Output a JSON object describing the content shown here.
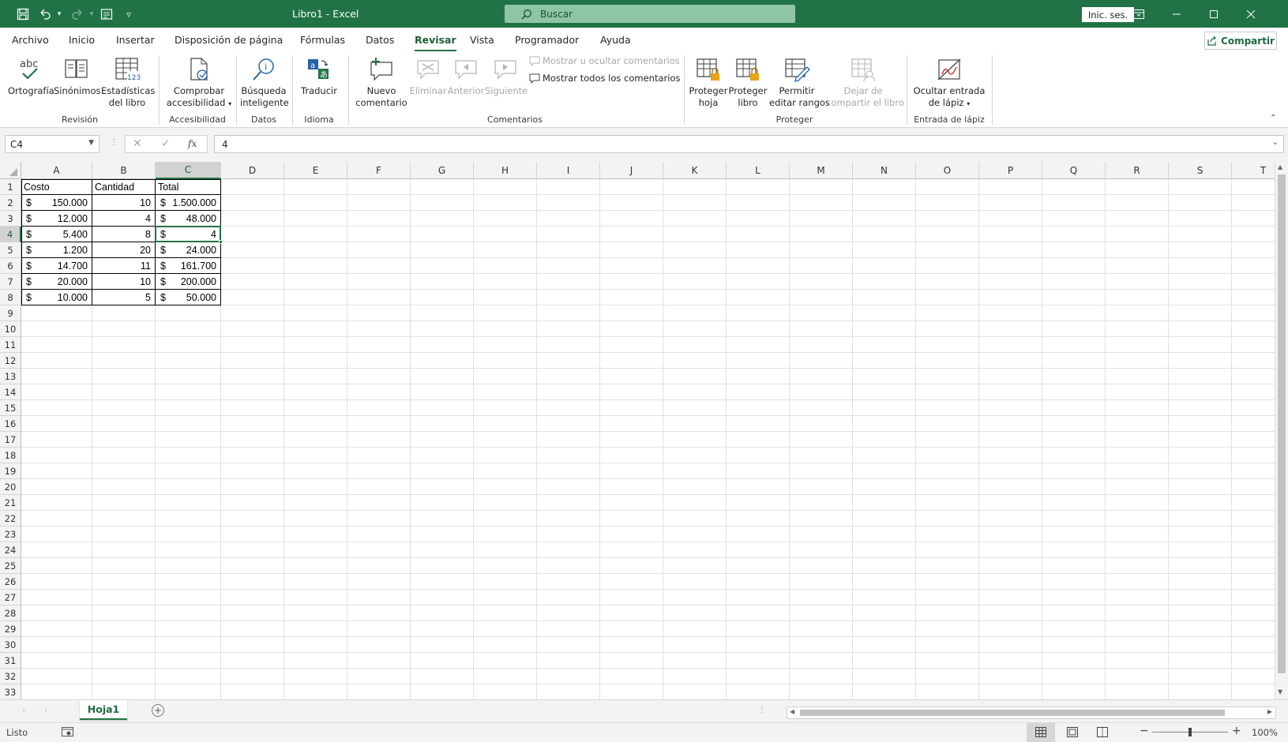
{
  "title_bar": {
    "title": "Libro1  -  Excel",
    "search_placeholder": "Buscar",
    "signin_label": "Inic. ses."
  },
  "menu_tabs": [
    "Archivo",
    "Inicio",
    "Insertar",
    "Disposición de página",
    "Fórmulas",
    "Datos",
    "Revisar",
    "Vista",
    "Programador",
    "Ayuda"
  ],
  "active_tab": "Revisar",
  "share_label": "Compartir",
  "ribbon": {
    "revision": {
      "spelling": "Ortografía",
      "thesaurus": "Sinónimos",
      "stats_1": "Estadísticas",
      "stats_2": "del libro",
      "group": "Revisión",
      "spell_icon_text": "abc"
    },
    "accessibility": {
      "check_1": "Comprobar",
      "check_2": "accesibilidad",
      "group": "Accesibilidad"
    },
    "datos": {
      "smart_1": "Búsqueda",
      "smart_2": "inteligente",
      "group": "Datos"
    },
    "idioma": {
      "translate": "Traducir",
      "group": "Idioma"
    },
    "comentarios": {
      "new_1": "Nuevo",
      "new_2": "comentario",
      "delete": "Eliminar",
      "previous": "Anterior",
      "next": "Siguiente",
      "show_hide": "Mostrar u ocultar comentarios",
      "show_all": "Mostrar todos los comentarios",
      "group": "Comentarios"
    },
    "proteger": {
      "sheet_1": "Proteger",
      "sheet_2": "hoja",
      "book_1": "Proteger",
      "book_2": "libro",
      "ranges_1": "Permitir",
      "ranges_2": "editar rangos",
      "unshare_1": "Dejar de",
      "unshare_2": "compartir el libro",
      "group": "Proteger"
    },
    "ink": {
      "hide_1": "Ocultar entrada",
      "hide_2": "de lápiz",
      "group": "Entrada de lápiz"
    }
  },
  "formula_bar": {
    "name_box": "C4",
    "formula": "4",
    "fx": "fx"
  },
  "columns": [
    "A",
    "B",
    "C",
    "D",
    "E",
    "F",
    "G",
    "H",
    "I",
    "J",
    "K",
    "L",
    "M",
    "N",
    "O",
    "P",
    "Q",
    "R",
    "S",
    "T"
  ],
  "rows": [
    "1",
    "2",
    "3",
    "4",
    "5",
    "6",
    "7",
    "8",
    "9",
    "10",
    "11",
    "12",
    "13",
    "14",
    "15",
    "16",
    "17",
    "18",
    "19",
    "20",
    "21",
    "22",
    "23",
    "24",
    "25",
    "26",
    "27",
    "28",
    "29",
    "30",
    "31",
    "32",
    "33"
  ],
  "selected_cell": "C4",
  "table": {
    "headers": [
      "Costo",
      "Cantidad",
      "Total"
    ],
    "currency": "$",
    "rows": [
      {
        "costo": "150.000",
        "cantidad": "10",
        "total": "1.500.000"
      },
      {
        "costo": "12.000",
        "cantidad": "4",
        "total": "48.000"
      },
      {
        "costo": "5.400",
        "cantidad": "8",
        "total": "4"
      },
      {
        "costo": "1.200",
        "cantidad": "20",
        "total": "24.000"
      },
      {
        "costo": "14.700",
        "cantidad": "11",
        "total": "161.700"
      },
      {
        "costo": "20.000",
        "cantidad": "10",
        "total": "200.000"
      },
      {
        "costo": "10.000",
        "cantidad": "5",
        "total": "50.000"
      }
    ]
  },
  "sheet_tab": "Hoja1",
  "status": {
    "ready": "Listo",
    "zoom": "100%"
  },
  "colors": {
    "accent": "#217346",
    "search_bg": "#8fc5a7"
  }
}
